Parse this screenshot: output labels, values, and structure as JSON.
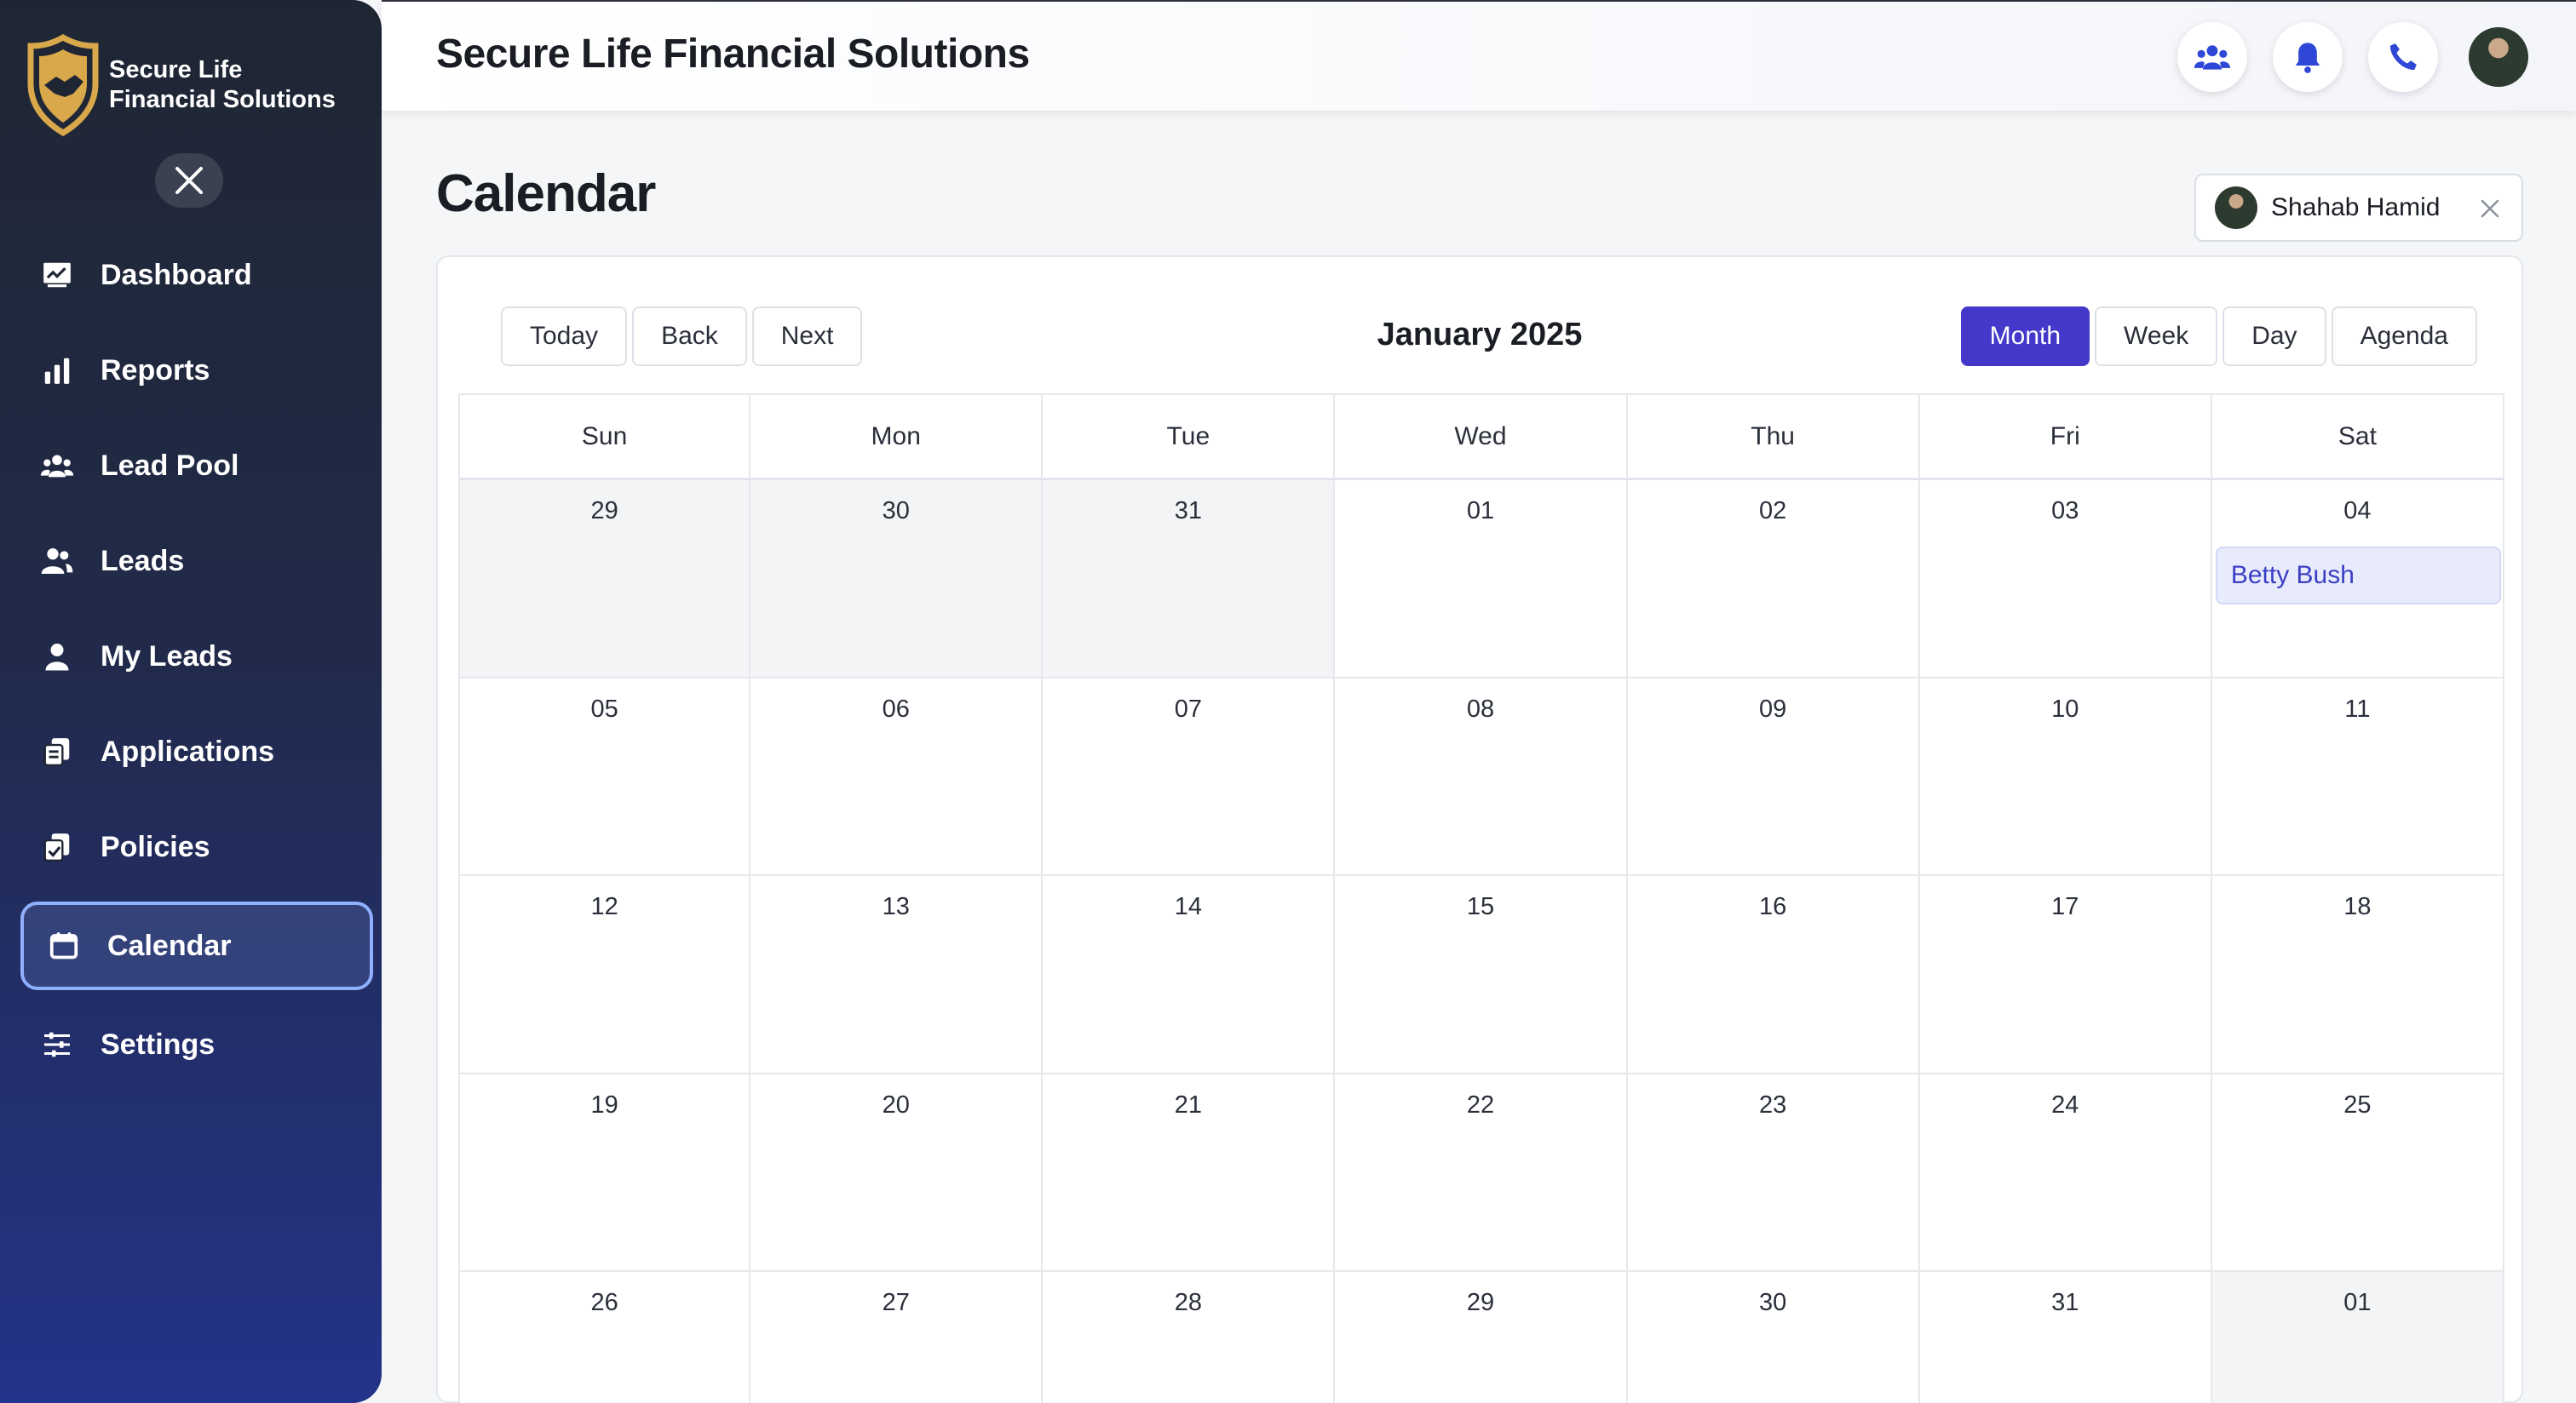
{
  "brand": {
    "line1": "Secure Life",
    "line2": "Financial Solutions"
  },
  "header": {
    "title": "Secure Life Financial Solutions"
  },
  "sidebar": {
    "items": [
      {
        "label": "Dashboard",
        "icon": "dashboard-icon"
      },
      {
        "label": "Reports",
        "icon": "bar-chart-icon"
      },
      {
        "label": "Lead Pool",
        "icon": "group-icon"
      },
      {
        "label": "Leads",
        "icon": "users-icon"
      },
      {
        "label": "My Leads",
        "icon": "user-icon"
      },
      {
        "label": "Applications",
        "icon": "applications-icon"
      },
      {
        "label": "Policies",
        "icon": "policies-icon"
      },
      {
        "label": "Calendar",
        "icon": "calendar-icon",
        "active": true
      },
      {
        "label": "Settings",
        "icon": "sliders-icon"
      }
    ]
  },
  "page": {
    "title": "Calendar"
  },
  "user_filter": {
    "name": "Shahab Hamid"
  },
  "calendar": {
    "label": "January 2025",
    "nav_buttons": [
      "Today",
      "Back",
      "Next"
    ],
    "views": [
      "Month",
      "Week",
      "Day",
      "Agenda"
    ],
    "active_view": "Month",
    "weekdays": [
      "Sun",
      "Mon",
      "Tue",
      "Wed",
      "Thu",
      "Fri",
      "Sat"
    ],
    "days": [
      {
        "n": "29",
        "off": true
      },
      {
        "n": "30",
        "off": true
      },
      {
        "n": "31",
        "off": true
      },
      {
        "n": "01"
      },
      {
        "n": "02"
      },
      {
        "n": "03"
      },
      {
        "n": "04",
        "event": "Betty Bush"
      },
      {
        "n": "05"
      },
      {
        "n": "06"
      },
      {
        "n": "07"
      },
      {
        "n": "08"
      },
      {
        "n": "09"
      },
      {
        "n": "10"
      },
      {
        "n": "11"
      },
      {
        "n": "12"
      },
      {
        "n": "13"
      },
      {
        "n": "14"
      },
      {
        "n": "15"
      },
      {
        "n": "16"
      },
      {
        "n": "17"
      },
      {
        "n": "18"
      },
      {
        "n": "19"
      },
      {
        "n": "20"
      },
      {
        "n": "21"
      },
      {
        "n": "22"
      },
      {
        "n": "23"
      },
      {
        "n": "24"
      },
      {
        "n": "25"
      },
      {
        "n": "26"
      },
      {
        "n": "27"
      },
      {
        "n": "28"
      },
      {
        "n": "29"
      },
      {
        "n": "30"
      },
      {
        "n": "31"
      },
      {
        "n": "01",
        "off": true
      }
    ]
  },
  "colors": {
    "accent": "#4338ca",
    "sidebar_top": "#1f2633",
    "sidebar_bottom": "#24338a",
    "event_bg": "#e8ebfb",
    "header_icon": "#2f47d6"
  }
}
